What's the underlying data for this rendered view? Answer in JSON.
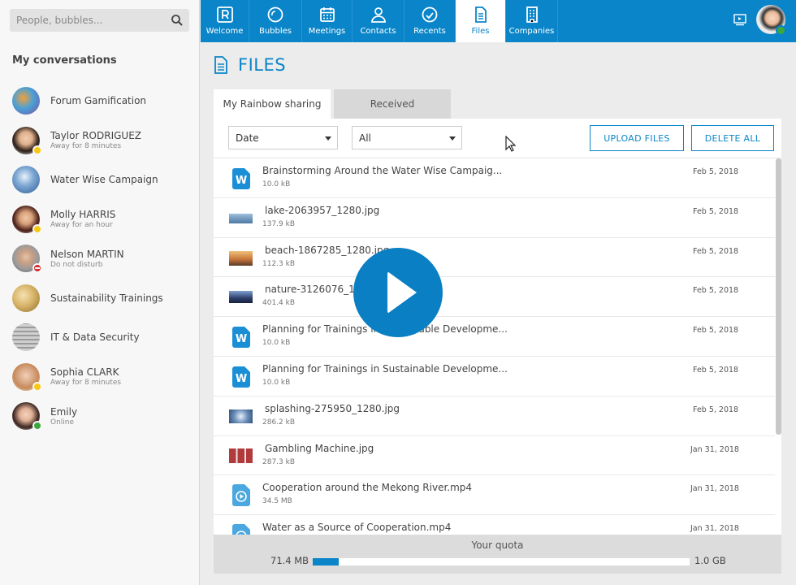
{
  "search": {
    "placeholder": "People, bubbles..."
  },
  "conversations": {
    "title": "My conversations",
    "items": [
      {
        "name": "Forum Gamification",
        "sub": "",
        "status": ""
      },
      {
        "name": "Taylor RODRIGUEZ",
        "sub": "Away for 8 minutes",
        "status": "away"
      },
      {
        "name": "Water Wise Campaign",
        "sub": "",
        "status": ""
      },
      {
        "name": "Molly HARRIS",
        "sub": "Away for an hour",
        "status": "away"
      },
      {
        "name": "Nelson MARTIN",
        "sub": "Do not disturb",
        "status": "dnd"
      },
      {
        "name": "Sustainability Trainings",
        "sub": "",
        "status": ""
      },
      {
        "name": "IT & Data Security",
        "sub": "",
        "status": ""
      },
      {
        "name": "Sophia CLARK",
        "sub": "Away for 8 minutes",
        "status": "away"
      },
      {
        "name": "Emily",
        "sub": "Online",
        "status": "online"
      }
    ]
  },
  "nav": {
    "tabs": [
      {
        "label": "Welcome",
        "icon": "rainbow-logo-icon"
      },
      {
        "label": "Bubbles",
        "icon": "bubble-icon"
      },
      {
        "label": "Meetings",
        "icon": "calendar-icon"
      },
      {
        "label": "Contacts",
        "icon": "person-icon"
      },
      {
        "label": "Recents",
        "icon": "clock-icon"
      },
      {
        "label": "Files",
        "icon": "file-icon",
        "active": true
      },
      {
        "label": "Companies",
        "icon": "building-icon"
      }
    ]
  },
  "page": {
    "title": "FILES"
  },
  "tabs": {
    "sharing": "My Rainbow sharing",
    "received": "Received"
  },
  "filters": {
    "sort": "Date",
    "type": "All"
  },
  "buttons": {
    "upload": "UPLOAD FILES",
    "delete_all": "DELETE ALL"
  },
  "files": [
    {
      "name": "Brainstorming Around the Water Wise Campaig...",
      "size": "10.0 kB",
      "date": "Feb 5, 2018",
      "kind": "word"
    },
    {
      "name": "lake-2063957_1280.jpg",
      "size": "137.9 kB",
      "date": "Feb 5, 2018",
      "kind": "image",
      "thumb": "#5b86b0"
    },
    {
      "name": "beach-1867285_1280.jpg",
      "size": "112.3 kB",
      "date": "Feb 5, 2018",
      "kind": "image",
      "thumb": "#c9773a"
    },
    {
      "name": "nature-3126076_128",
      "size": "401.4 kB",
      "date": "Feb 5, 2018",
      "kind": "image",
      "thumb": "#2d3f6b"
    },
    {
      "name": "Planning for Trainings in Sustainable Developme...",
      "size": "10.0 kB",
      "date": "Feb 5, 2018",
      "kind": "word"
    },
    {
      "name": "Planning for Trainings in Sustainable Developme...",
      "size": "10.0 kB",
      "date": "Feb 5, 2018",
      "kind": "word"
    },
    {
      "name": "splashing-275950_1280.jpg",
      "size": "286.2 kB",
      "date": "Feb 5, 2018",
      "kind": "image",
      "thumb": "#6b8fb8"
    },
    {
      "name": "Gambling Machine.jpg",
      "size": "287.3 kB",
      "date": "Jan 31, 2018",
      "kind": "image",
      "thumb": "#b23a3a"
    },
    {
      "name": "Cooperation around the Mekong River.mp4",
      "size": "34.5 MB",
      "date": "Jan 31, 2018",
      "kind": "video"
    },
    {
      "name": "Water as a Source of Cooperation.mp4",
      "size": "",
      "date": "Jan 31, 2018",
      "kind": "video"
    }
  ],
  "quota": {
    "label": "Your quota",
    "used": "71.4 MB",
    "total": "1.0 GB",
    "fraction": 0.07
  },
  "colors": {
    "accent": "#0a85c9",
    "away": "#f6c811",
    "online": "#3aa83a",
    "dnd": "#d9262b"
  }
}
